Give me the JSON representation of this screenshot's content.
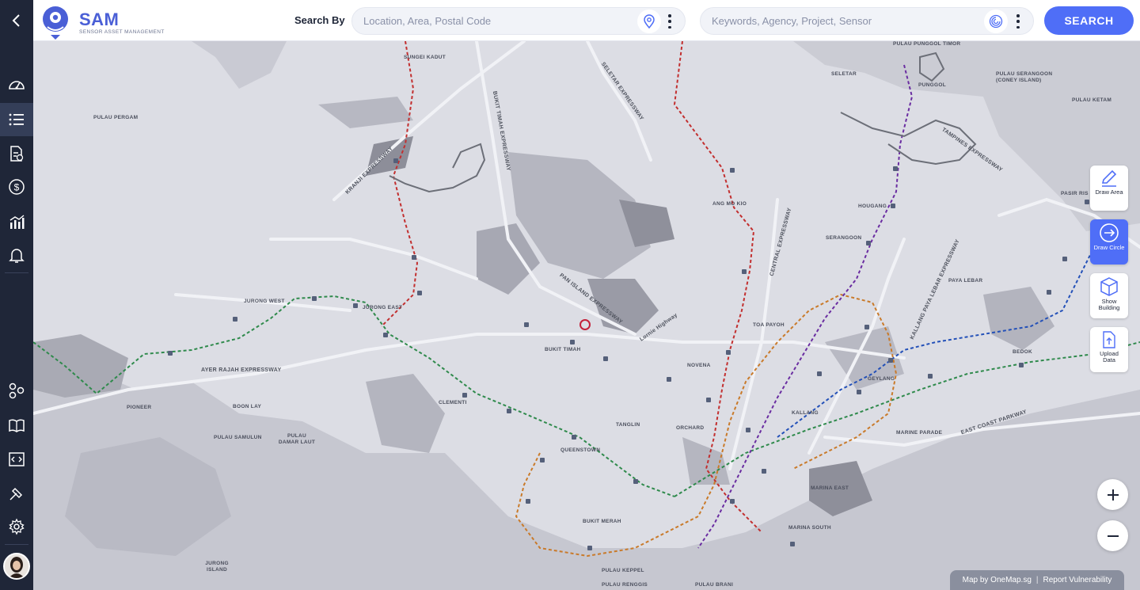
{
  "app": {
    "logo_title": "SAM",
    "logo_subtitle": "SENSOR ASSET MANAGEMENT"
  },
  "sidebar": {
    "back_icon": "chevron-left-icon",
    "items": [
      {
        "icon": "dashboard-icon",
        "active": false
      },
      {
        "icon": "list-icon",
        "active": true
      },
      {
        "icon": "document-upload-icon",
        "active": false
      },
      {
        "icon": "dollar-icon",
        "active": false
      },
      {
        "icon": "analytics-icon",
        "active": false
      },
      {
        "icon": "bell-icon",
        "active": false
      },
      {
        "icon": "integrations-icon",
        "active": false
      },
      {
        "icon": "book-icon",
        "active": false
      },
      {
        "icon": "code-editor-icon",
        "active": false
      },
      {
        "icon": "tools-icon",
        "active": false
      },
      {
        "icon": "settings-icon",
        "active": false
      }
    ]
  },
  "header": {
    "search_by_label": "Search By",
    "location_placeholder": "Location, Area, Postal Code",
    "keyword_placeholder": "Keywords, Agency, Project, Sensor",
    "search_button": "SEARCH"
  },
  "map_tools": [
    {
      "label": "Draw Area",
      "icon": "pencil-icon",
      "active": false
    },
    {
      "label": "Draw Circle",
      "icon": "circle-arrow-icon",
      "active": true
    },
    {
      "label": "Show Building",
      "icon": "cube-icon",
      "active": false
    },
    {
      "label": "Upload Data",
      "icon": "file-upload-icon",
      "active": false
    }
  ],
  "attribution": {
    "provider": "Map by OneMap.sg",
    "separator": "|",
    "report": "Report Vulnerability"
  },
  "map_labels": [
    "SUNGEI KADUT",
    "PULAU PERGAM",
    "KRANJI EXPRESSWAY",
    "BUKIT TIMAH EXPRESSWAY",
    "SELETAR EXPRESSWAY",
    "SELETAR",
    "PULAU PUNGGOL TIMOR",
    "PUNGGOL",
    "PULAU SERANGOON (CONEY ISLAND)",
    "PULAU KETAM",
    "TAMPINES EXPRESSWAY",
    "ANG MO KIO",
    "HOUGANG",
    "PASIR RIS",
    "SERANGOON",
    "CENTRAL EXPRESSWAY",
    "KALLANG PAYA LEBAR EXPRESSWAY",
    "PAYA LEBAR",
    "PAN ISLAND EXPRESSWAY",
    "Lornie Highway",
    "JURONG WEST",
    "JURONG EAST",
    "BUKIT TIMAH",
    "TOA PAYOH",
    "NOVENA",
    "AYER RAJAH EXPRESSWAY",
    "BEDOK",
    "GEYLANG",
    "PIONEER",
    "BOON LAY",
    "CLEMENTI",
    "ORCHARD",
    "KALLANG",
    "TANGLIN",
    "EAST COAST PARKWAY",
    "PULAU SAMULUN",
    "PULAU DAMAR LAUT",
    "MARINE PARADE",
    "QUEENSTOWN",
    "MARINA EAST",
    "MARINA SOUTH",
    "BUKIT MERAH",
    "PULAU KEPPEL",
    "JURONG ISLAND",
    "PULAU RENGGIS",
    "PULAU BRANI"
  ]
}
